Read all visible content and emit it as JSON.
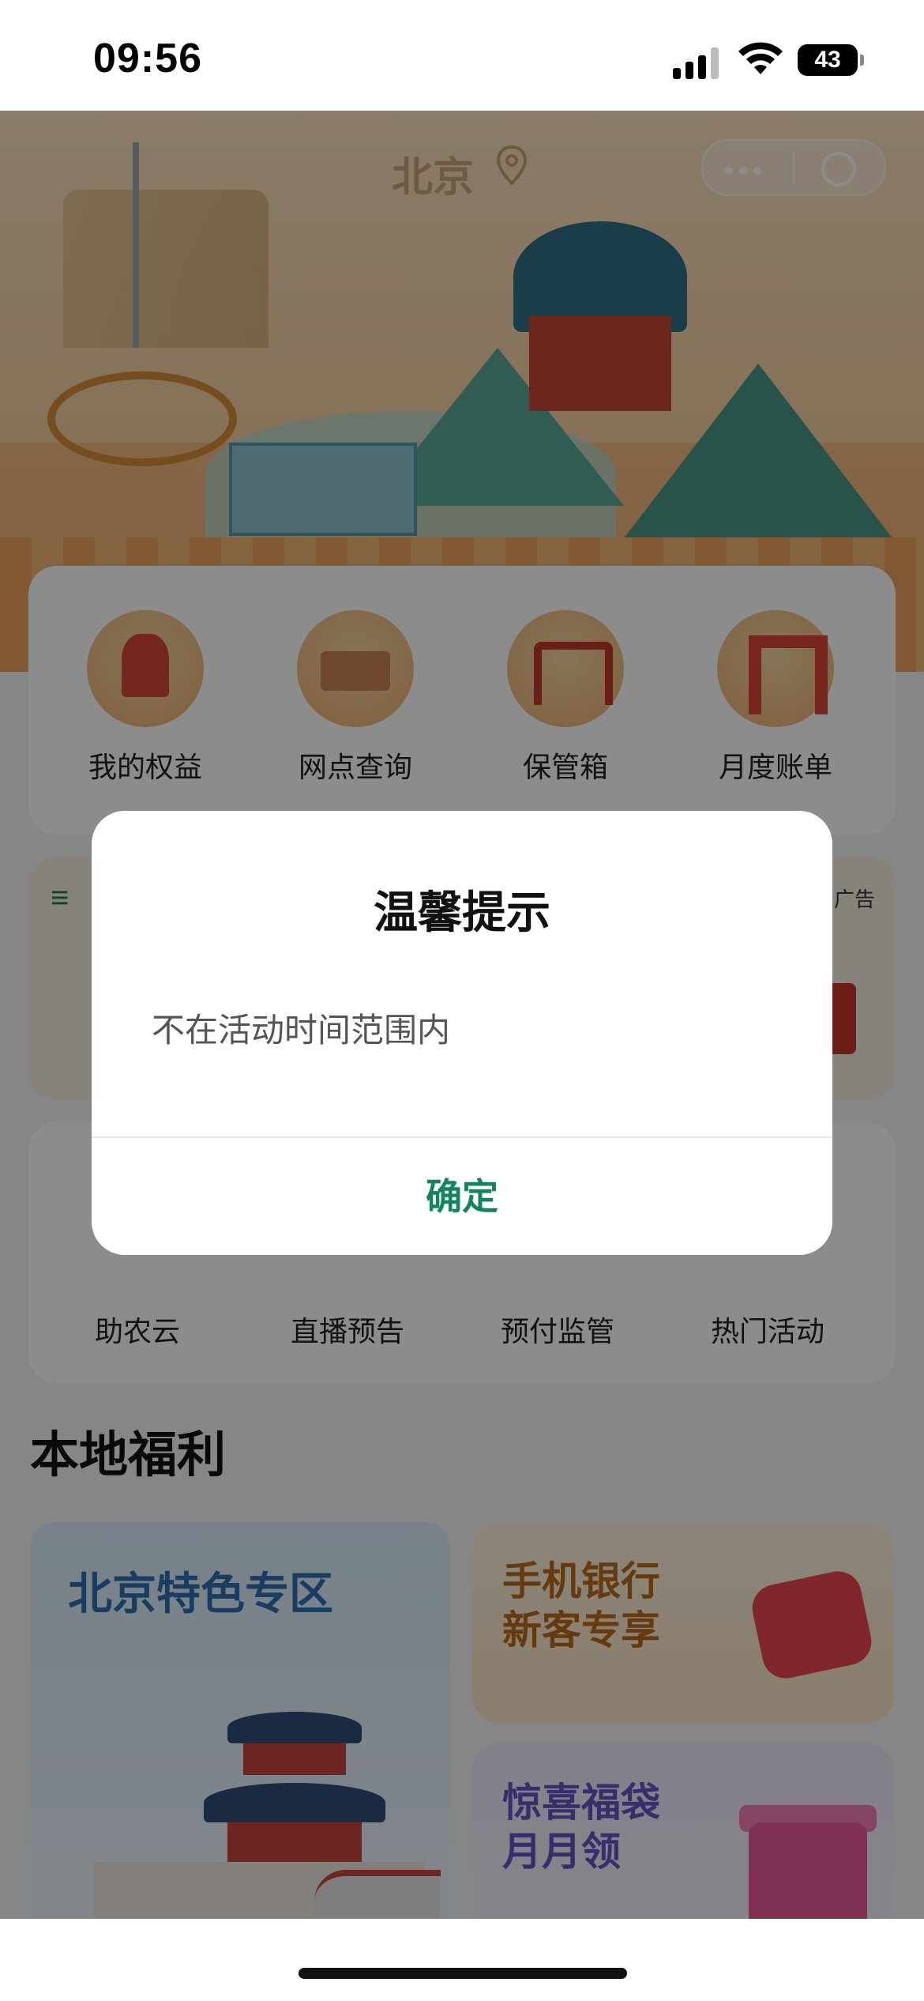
{
  "status_bar": {
    "time": "09:56",
    "battery": "43"
  },
  "header": {
    "city": "北京"
  },
  "quick_actions": [
    {
      "label": "我的权益",
      "icon": "temple-of-heaven-icon"
    },
    {
      "label": "网点查询",
      "icon": "great-wall-icon"
    },
    {
      "label": "保管箱",
      "icon": "archway-icon"
    },
    {
      "label": "月度账单",
      "icon": "cctv-building-icon"
    }
  ],
  "ad_banner": {
    "badge": "广告"
  },
  "services": [
    {
      "label": "助农云"
    },
    {
      "label": "直播预告"
    },
    {
      "label": "预付监管"
    },
    {
      "label": "热门活动"
    }
  ],
  "local_benefits": {
    "title": "本地福利",
    "cards": [
      {
        "title": "北京特色专区"
      },
      {
        "title_line1": "手机银行",
        "title_line2": "新客专享"
      },
      {
        "title_line1": "惊喜福袋",
        "title_line2": "月月领"
      }
    ]
  },
  "dialog": {
    "title": "温馨提示",
    "message": "不在活动时间范围内",
    "confirm_label": "确定"
  },
  "colors": {
    "accent": "#12855a",
    "overlay": "rgba(0,0,0,0.45)",
    "benefit_blue": "#2c6fb0",
    "benefit_orange": "#b86a1d",
    "benefit_purple": "#6b53c4"
  }
}
